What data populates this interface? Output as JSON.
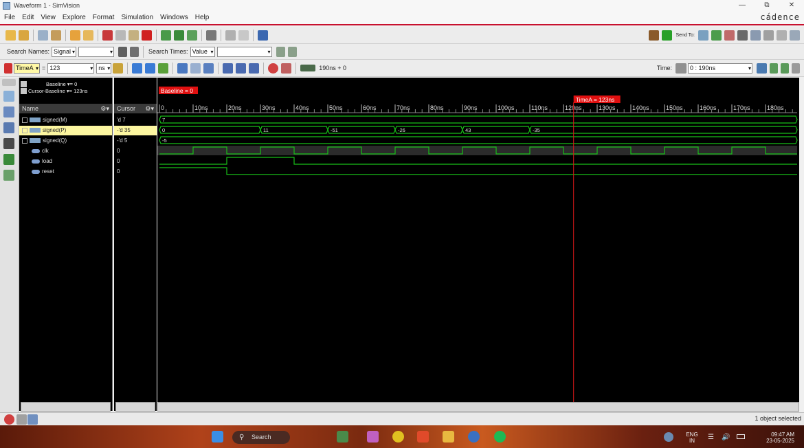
{
  "window": {
    "title": "Waveform 1 - SimVision",
    "controls": [
      "—",
      "⧉",
      "✕"
    ]
  },
  "menu": {
    "items": [
      "File",
      "Edit",
      "View",
      "Explore",
      "Format",
      "Simulation",
      "Windows",
      "Help"
    ],
    "brand": "cádence"
  },
  "toolbar2": {
    "search_names_label": "Search Names:",
    "search_names_type": "Signal",
    "search_names_value": "",
    "search_times_label": "Search Times:",
    "search_times_type": "Value",
    "search_times_value": ""
  },
  "toolbar3": {
    "cursor_name": "TimeA",
    "cursor_eq": "=",
    "cursor_value": "123",
    "cursor_unit": "ns",
    "sim_time": "190ns + 0",
    "time_label": "Time:",
    "time_range": "0 : 190ns"
  },
  "panel": {
    "baseline_line": "Baseline ▾= 0",
    "cursor_baseline_line": "Cursor-Baseline ▾= 123ns",
    "name_header": "Name",
    "cursor_header": "Cursor"
  },
  "signals": [
    {
      "name": "signed(M)",
      "value": "'d 7",
      "type": "bus",
      "expandable": true
    },
    {
      "name": "signed(P)",
      "value": "-'d 35",
      "type": "bus",
      "expandable": true,
      "selected": true
    },
    {
      "name": "signed(Q)",
      "value": "-'d 5",
      "type": "bus",
      "expandable": true
    },
    {
      "name": "clk",
      "value": "0",
      "type": "wire"
    },
    {
      "name": "load",
      "value": "0",
      "type": "wire"
    },
    {
      "name": "reset",
      "value": "0",
      "type": "wire"
    }
  ],
  "waveform": {
    "baseline_marker": "Baseline = 0",
    "cursor_marker": "TimeA = 123ns",
    "cursor_time": 123,
    "time_end": 190,
    "ruler_labels": [
      "0",
      "10ns",
      "20ns",
      "30ns",
      "40ns",
      "50ns",
      "60ns",
      "70ns",
      "80ns",
      "90ns",
      "100ns",
      "110ns",
      "120ns",
      "130ns",
      "140ns",
      "150ns",
      "160ns",
      "170ns",
      "180ns"
    ],
    "ruler_times": [
      0,
      10,
      20,
      30,
      40,
      50,
      60,
      70,
      80,
      90,
      100,
      110,
      120,
      130,
      140,
      150,
      160,
      170,
      180
    ],
    "bus_segments": {
      "signed(M)": [
        {
          "start": 0,
          "end": 190,
          "label": "7"
        }
      ],
      "signed(P)": [
        {
          "start": 0,
          "end": 30,
          "label": "0"
        },
        {
          "start": 30,
          "end": 50,
          "label": "11"
        },
        {
          "start": 50,
          "end": 70,
          "label": "-51"
        },
        {
          "start": 70,
          "end": 90,
          "label": "-26"
        },
        {
          "start": 90,
          "end": 110,
          "label": "43"
        },
        {
          "start": 110,
          "end": 190,
          "label": "-35"
        }
      ],
      "signed(Q)": [
        {
          "start": 0,
          "end": 190,
          "label": "-5"
        }
      ]
    },
    "clk_period": 20,
    "clk_first_rise": 10,
    "load_high": [
      20,
      40
    ],
    "reset_high": [
      0,
      20
    ],
    "colors": {
      "wave": "#18c018",
      "cursor": "#d81818",
      "marker_bg": "#e01010",
      "grid_tick": "#bbbbbb"
    }
  },
  "status": {
    "text": "1 object selected"
  },
  "taskbar": {
    "search_label": "Search",
    "lang_top": "ENG",
    "lang_bottom": "IN",
    "time": "09:47 AM",
    "date": "23-05-2025"
  }
}
